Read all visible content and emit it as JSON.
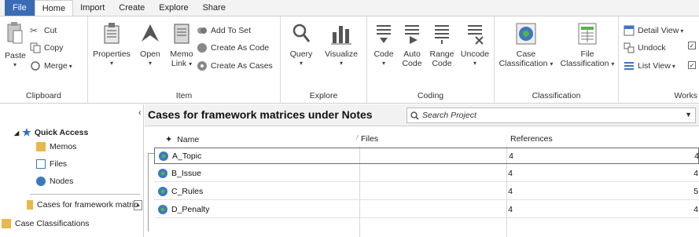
{
  "menu": {
    "tabs": [
      "File",
      "Home",
      "Import",
      "Create",
      "Explore",
      "Share"
    ],
    "active": "Home"
  },
  "ribbon": {
    "clipboard": {
      "paste": "Paste",
      "cut": "Cut",
      "copy": "Copy",
      "merge": "Merge",
      "label": "Clipboard"
    },
    "item": {
      "properties": "Properties",
      "open": "Open",
      "memo_link_1": "Memo",
      "memo_link_2": "Link",
      "add_to_set": "Add To Set",
      "create_as_code": "Create As Code",
      "create_as_cases": "Create As Cases",
      "label": "Item"
    },
    "explore": {
      "query": "Query",
      "visualize": "Visualize",
      "label": "Explore"
    },
    "coding": {
      "code": "Code",
      "auto_code_1": "Auto",
      "auto_code_2": "Code",
      "range_code_1": "Range",
      "range_code_2": "Code",
      "uncode": "Uncode",
      "label": "Coding"
    },
    "classification": {
      "case_1": "Case",
      "case_2": "Classification",
      "file_1": "File",
      "file_2": "Classification",
      "label": "Classification"
    },
    "workspace": {
      "detail_view": "Detail View",
      "undock": "Undock",
      "list_view": "List View",
      "label": "Works"
    }
  },
  "nav": {
    "quick_access": "Quick Access",
    "memos": "Memos",
    "files": "Files",
    "nodes": "Nodes",
    "cases_framework": "Cases for framework matric",
    "case_classifications": "Case Classifications"
  },
  "content": {
    "title": "Cases for framework matrices under Notes",
    "search_placeholder": "Search Project",
    "columns": {
      "name": "Name",
      "files": "Files",
      "references": "References"
    },
    "rows": [
      {
        "name": "A_Topic",
        "files": "4",
        "references": "4"
      },
      {
        "name": "B_Issue",
        "files": "4",
        "references": "4"
      },
      {
        "name": "C_Rules",
        "files": "4",
        "references": "5"
      },
      {
        "name": "D_Penalty",
        "files": "4",
        "references": "4"
      }
    ]
  },
  "colors": {
    "file_tab": "#3a6bb5",
    "case_icon_blue": "#3b78c2",
    "case_icon_green": "#5bb04a",
    "folder_yellow": "#e8b84a",
    "star_blue": "#2e6fc9"
  }
}
